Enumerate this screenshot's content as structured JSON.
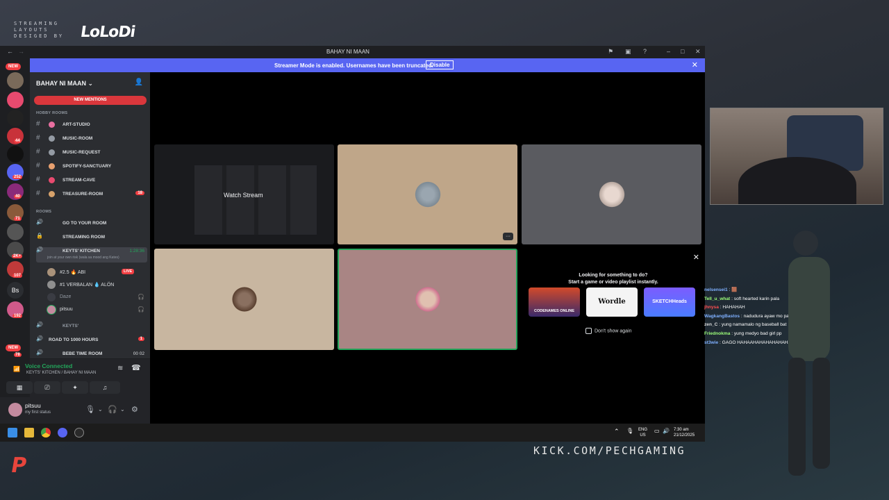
{
  "overlay": {
    "layout_credit": "STREAMING\nLAYOUTS\nDESIGED BY",
    "layout_logo": "LoLoDi",
    "kick_url": "KICK.COM/PECHGAMING",
    "brand_letter": "P"
  },
  "window": {
    "title": "BAHAY NI MAAN",
    "banner_text": "Streamer Mode is enabled. Usernames have been truncated.",
    "banner_button": "Disable"
  },
  "servers": {
    "new_label": "NEW",
    "badges": [
      "44",
      "252",
      "40",
      "71",
      "2K+",
      "107",
      "192",
      "78"
    ],
    "initials": "Bs"
  },
  "sidebar": {
    "guild_name": "BAHAY NI MAAN",
    "new_mentions": "NEW MENTIONS",
    "hobby_category": "HOBBY ROOMS",
    "text_channels": [
      {
        "name": "ART-STUDIO",
        "color": "#e86fa0"
      },
      {
        "name": "MUSIC-ROOM",
        "color": "#949ba4"
      },
      {
        "name": "MUSIC-REQUEST",
        "color": "#949ba4"
      },
      {
        "name": "SPOTIFY-SANCTUARY",
        "color": "#e8a06f"
      },
      {
        "name": "STREAM-CAVE",
        "color": "#e84a6f"
      },
      {
        "name": "TREASURE-ROOM",
        "color": "#d7a26b",
        "count": "18"
      }
    ],
    "rooms_category": "ROOMS",
    "voice_channels": [
      {
        "name": "GO TO YOUR ROOM"
      },
      {
        "name": "STREAMING ROOM"
      },
      {
        "name": "KEYTS' KITCHEN",
        "time": "1:28:36",
        "sub": "join at your own risk (wala sa mood ang Kates)"
      }
    ],
    "voice_users": [
      {
        "name": "#2.5 🔥 ABI",
        "live": "LIVE"
      },
      {
        "name": "#1 VERBALAN 💧 ALÖN"
      },
      {
        "name": "Daze"
      },
      {
        "name": "pitsuu"
      }
    ],
    "more_channels": [
      {
        "name": "KEYTS'"
      },
      {
        "name": "ROAD TO 1000 HOURS",
        "count": "1"
      },
      {
        "name": "BEBE TIME ROOM",
        "time": "00 02"
      }
    ],
    "voice_status": "Voice Connected",
    "voice_sub": "KEYTS' KITCHEN / BAHAY NI MAAN",
    "username": "pitsuu",
    "user_status": "my first status"
  },
  "stage": {
    "watch_stream": "Watch Stream",
    "more": "···",
    "suggest_title": "Looking for something to do?",
    "suggest_sub": "Start a game or video playlist instantly.",
    "games": [
      "CODENAMES ONLINE",
      "Wordle",
      "SKETCHHeads"
    ],
    "dont_show": "Don't show again"
  },
  "taskbar": {
    "lang": "ENG\nUS",
    "time": "7:30 am",
    "date": "21/12/2025"
  },
  "chat": [
    {
      "user": "nelsensei1",
      "msg": "🟫",
      "color": "#7fb0ff"
    },
    {
      "user": "Tell_u_what",
      "msg": "soft hearted karin pala",
      "color": "#9dff7a"
    },
    {
      "user": "jhnysa",
      "msg": "HAHAHAH",
      "color": "#ff4f4f"
    },
    {
      "user": "WagkangBastos",
      "msg": "nadudura ayaw mo parang si diggy",
      "color": "#7fb0ff"
    },
    {
      "user": "zen_C",
      "msg": "yung namamalo ng baseball bat",
      "color": "#dcdcdc"
    },
    {
      "user": "Friednokma",
      "msg": "yung medyo bad girl pp",
      "color": "#9dff7a"
    },
    {
      "user": "st3wie",
      "msg": "GAGO HAHAAHAHAHAHAHAHAH",
      "color": "#7fb0ff"
    }
  ]
}
